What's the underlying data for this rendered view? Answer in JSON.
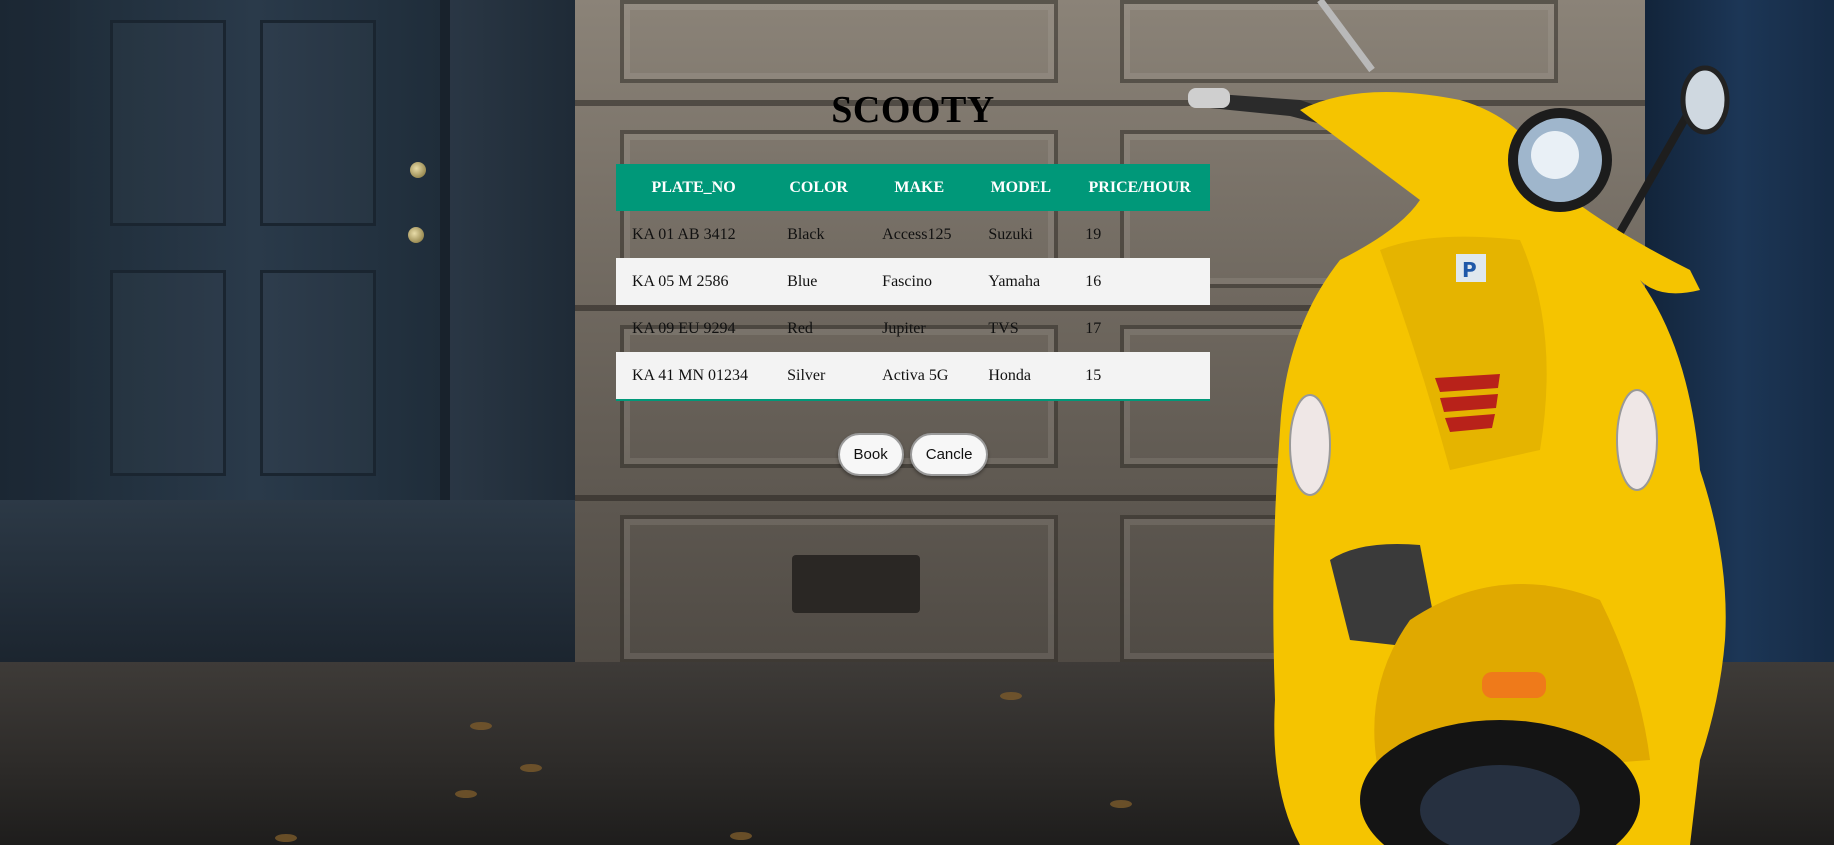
{
  "page": {
    "title": "SCOOTY"
  },
  "table": {
    "headers": [
      "PLATE_NO",
      "COLOR",
      "MAKE",
      "MODEL",
      "PRICE/HOUR"
    ],
    "rows": [
      [
        "KA 01 AB 3412",
        "Black",
        "Access125",
        "Suzuki",
        "19"
      ],
      [
        "KA 05 M 2586",
        "Blue",
        "Fascino",
        "Yamaha",
        "16"
      ],
      [
        "KA 09 EU 9294",
        "Red",
        "Jupiter",
        "TVS",
        "17"
      ],
      [
        "KA 41 MN 01234",
        "Silver",
        "Activa 5G",
        "Honda",
        "15"
      ]
    ]
  },
  "buttons": {
    "book": "Book",
    "cancel": "Cancle"
  },
  "colors": {
    "header_bg": "#009879",
    "header_text": "#ffffff",
    "alt_row_bg": "#f3f3f3",
    "scooter_yellow": "#f5c400"
  },
  "background": {
    "icons": [
      "door-icon",
      "garage-door-icon",
      "scooter-image"
    ]
  }
}
